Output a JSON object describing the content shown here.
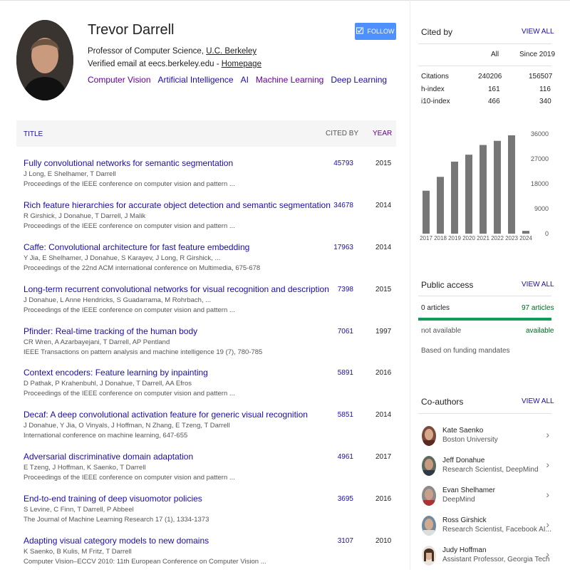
{
  "profile": {
    "name": "Trevor Darrell",
    "affiliation_prefix": "Professor of Computer Science, ",
    "affiliation_link": "U.C. Berkeley",
    "email_prefix": "Verified email at eecs.berkeley.edu - ",
    "homepage": "Homepage",
    "interests": [
      "Computer Vision",
      "Artificial Intelligence",
      "AI",
      "Machine Learning",
      "Deep Learning"
    ],
    "follow_label": "FOLLOW"
  },
  "table": {
    "headers": {
      "title": "TITLE",
      "cited_by": "CITED BY",
      "year": "YEAR"
    },
    "rows": [
      {
        "title": "Fully convolutional networks for semantic segmentation",
        "authors": "J Long, E Shelhamer, T Darrell",
        "venue": "Proceedings of the IEEE conference on computer vision and pattern ...",
        "cited_by": "45793",
        "year": "2015"
      },
      {
        "title": "Rich feature hierarchies for accurate object detection and semantic segmentation",
        "authors": "R Girshick, J Donahue, T Darrell, J Malik",
        "venue": "Proceedings of the IEEE conference on computer vision and pattern ...",
        "cited_by": "34678",
        "year": "2014"
      },
      {
        "title": "Caffe: Convolutional architecture for fast feature embedding",
        "authors": "Y Jia, E Shelhamer, J Donahue, S Karayev, J Long, R Girshick, ...",
        "venue": "Proceedings of the 22nd ACM international conference on Multimedia, 675-678",
        "cited_by": "17963",
        "year": "2014"
      },
      {
        "title": "Long-term recurrent convolutional networks for visual recognition and description",
        "authors": "J Donahue, L Anne Hendricks, S Guadarrama, M Rohrbach, ...",
        "venue": "Proceedings of the IEEE conference on computer vision and pattern ...",
        "cited_by": "7398",
        "year": "2015"
      },
      {
        "title": "Pfinder: Real-time tracking of the human body",
        "authors": "CR Wren, A Azarbayejani, T Darrell, AP Pentland",
        "venue": "IEEE Transactions on pattern analysis and machine intelligence 19 (7), 780-785",
        "cited_by": "7061",
        "year": "1997"
      },
      {
        "title": "Context encoders: Feature learning by inpainting",
        "authors": "D Pathak, P Krahenbuhl, J Donahue, T Darrell, AA Efros",
        "venue": "Proceedings of the IEEE conference on computer vision and pattern ...",
        "cited_by": "5891",
        "year": "2016"
      },
      {
        "title": "Decaf: A deep convolutional activation feature for generic visual recognition",
        "authors": "J Donahue, Y Jia, O Vinyals, J Hoffman, N Zhang, E Tzeng, T Darrell",
        "venue": "International conference on machine learning, 647-655",
        "cited_by": "5851",
        "year": "2014"
      },
      {
        "title": "Adversarial discriminative domain adaptation",
        "authors": "E Tzeng, J Hoffman, K Saenko, T Darrell",
        "venue": "Proceedings of the IEEE conference on computer vision and pattern ...",
        "cited_by": "4961",
        "year": "2017"
      },
      {
        "title": "End-to-end training of deep visuomotor policies",
        "authors": "S Levine, C Finn, T Darrell, P Abbeel",
        "venue": "The Journal of Machine Learning Research 17 (1), 1334-1373",
        "cited_by": "3695",
        "year": "2016"
      },
      {
        "title": "Adapting visual category models to new domains",
        "authors": "K Saenko, B Kulis, M Fritz, T Darrell",
        "venue": "Computer Vision–ECCV 2010: 11th European Conference on Computer Vision ...",
        "cited_by": "3107",
        "year": "2010"
      }
    ]
  },
  "cited_by": {
    "title": "Cited by",
    "view_all": "VIEW ALL",
    "col_all": "All",
    "col_since": "Since 2019",
    "stats": [
      {
        "label": "Citations",
        "all": "240206",
        "since": "156507"
      },
      {
        "label": "h-index",
        "all": "161",
        "since": "116"
      },
      {
        "label": "i10-index",
        "all": "466",
        "since": "340"
      }
    ]
  },
  "chart_data": {
    "type": "bar",
    "categories": [
      "2017",
      "2018",
      "2019",
      "2020",
      "2021",
      "2022",
      "2023",
      "2024"
    ],
    "values": [
      15500,
      20500,
      26000,
      28500,
      32000,
      33500,
      35500,
      1000
    ],
    "y_ticks": [
      "36000",
      "27000",
      "18000",
      "9000",
      "0"
    ],
    "ylim": [
      0,
      36000
    ],
    "bar_color": "#777777"
  },
  "public_access": {
    "title": "Public access",
    "view_all": "VIEW ALL",
    "left_count": "0 articles",
    "right_count": "97 articles",
    "left_status": "not available",
    "right_status": "available",
    "note": "Based on funding mandates"
  },
  "coauthors": {
    "title": "Co-authors",
    "view_all": "VIEW ALL",
    "items": [
      {
        "name": "Kate Saenko",
        "affiliation": "Boston University"
      },
      {
        "name": "Jeff Donahue",
        "affiliation": "Research Scientist, DeepMind"
      },
      {
        "name": "Evan Shelhamer",
        "affiliation": "DeepMind"
      },
      {
        "name": "Ross Girshick",
        "affiliation": "Research Scientist, Facebook AI..."
      },
      {
        "name": "Judy Hoffman",
        "affiliation": "Assistant Professor, Georgia Tech"
      }
    ]
  },
  "colors": {
    "link": "#1a0dab",
    "visited": "#660099",
    "accent": "#4d90fe",
    "green": "#0f9d58"
  }
}
